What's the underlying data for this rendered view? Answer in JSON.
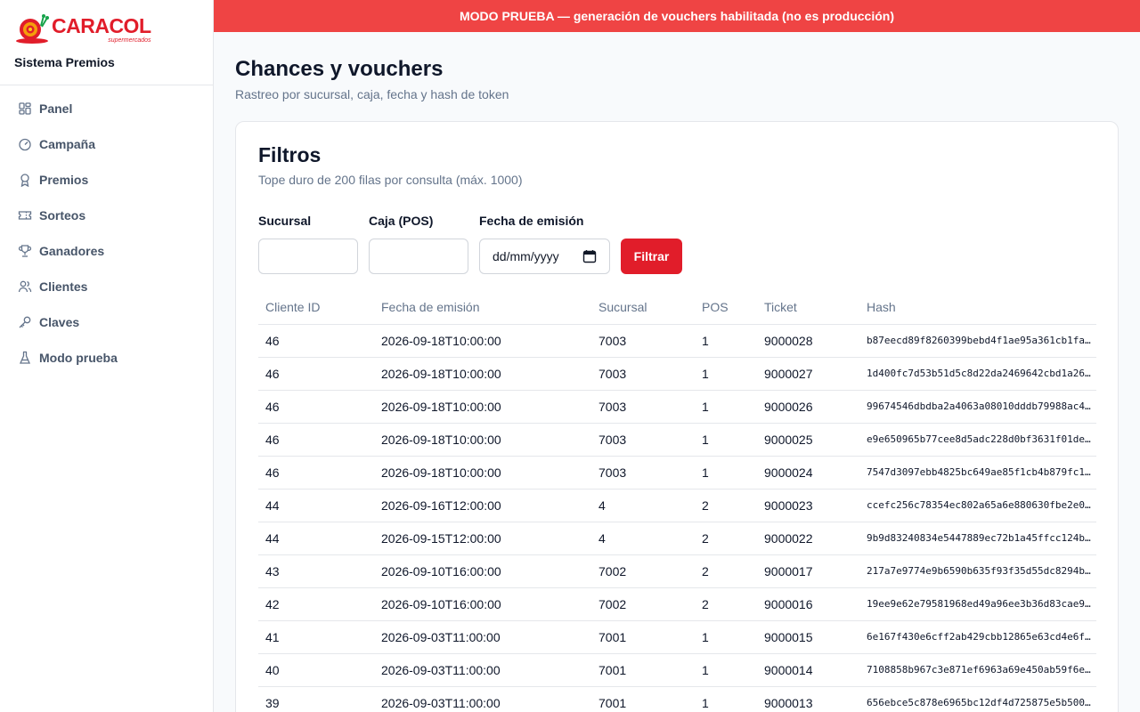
{
  "brand": {
    "logo_word": "CARACOL",
    "logo_sub": "supermercados",
    "system_name": "Sistema Premios"
  },
  "sidebar": {
    "items": [
      {
        "label": "Panel",
        "icon": "grid-icon"
      },
      {
        "label": "Campaña",
        "icon": "gauge-icon"
      },
      {
        "label": "Premios",
        "icon": "award-icon"
      },
      {
        "label": "Sorteos",
        "icon": "ticket-icon"
      },
      {
        "label": "Ganadores",
        "icon": "trophy-icon"
      },
      {
        "label": "Clientes",
        "icon": "users-icon"
      },
      {
        "label": "Claves",
        "icon": "key-icon"
      },
      {
        "label": "Modo prueba",
        "icon": "flask-icon"
      }
    ]
  },
  "banner": {
    "text": "MODO PRUEBA — generación de vouchers habilitada (no es producción)"
  },
  "page": {
    "title": "Chances y vouchers",
    "subtitle": "Rastreo por sucursal, caja, fecha y hash de token"
  },
  "filters": {
    "title": "Filtros",
    "subtitle": "Tope duro de 200 filas por consulta (máx. 1000)",
    "sucursal_label": "Sucursal",
    "sucursal_value": "",
    "caja_label": "Caja (POS)",
    "caja_value": "",
    "fecha_label": "Fecha de emisión",
    "fecha_placeholder": "dd/mm/yyyy",
    "button_label": "Filtrar"
  },
  "table": {
    "columns": [
      "Cliente ID",
      "Fecha de emisión",
      "Sucursal",
      "POS",
      "Ticket",
      "Hash"
    ],
    "rows": [
      [
        "46",
        "2026-09-18T10:00:00",
        "7003",
        "1",
        "9000028",
        "b87eecd89f8260399bebd4f1ae95a361cb1fa…"
      ],
      [
        "46",
        "2026-09-18T10:00:00",
        "7003",
        "1",
        "9000027",
        "1d400fc7d53b51d5c8d22da2469642cbd1a26…"
      ],
      [
        "46",
        "2026-09-18T10:00:00",
        "7003",
        "1",
        "9000026",
        "99674546dbdba2a4063a08010dddb79988ac4…"
      ],
      [
        "46",
        "2026-09-18T10:00:00",
        "7003",
        "1",
        "9000025",
        "e9e650965b77cee8d5adc228d0bf3631f01de…"
      ],
      [
        "46",
        "2026-09-18T10:00:00",
        "7003",
        "1",
        "9000024",
        "7547d3097ebb4825bc649ae85f1cb4b879fc1…"
      ],
      [
        "44",
        "2026-09-16T12:00:00",
        "4",
        "2",
        "9000023",
        "ccefc256c78354ec802a65a6e880630fbe2e0…"
      ],
      [
        "44",
        "2026-09-15T12:00:00",
        "4",
        "2",
        "9000022",
        "9b9d83240834e5447889ec72b1a45ffcc124b…"
      ],
      [
        "43",
        "2026-09-10T16:00:00",
        "7002",
        "2",
        "9000017",
        "217a7e9774e9b6590b635f93f35d55dc8294b…"
      ],
      [
        "42",
        "2026-09-10T16:00:00",
        "7002",
        "2",
        "9000016",
        "19ee9e62e79581968ed49a96ee3b36d83cae9…"
      ],
      [
        "41",
        "2026-09-03T11:00:00",
        "7001",
        "1",
        "9000015",
        "6e167f430e6cff2ab429cbb12865e63cd4e6f…"
      ],
      [
        "40",
        "2026-09-03T11:00:00",
        "7001",
        "1",
        "9000014",
        "7108858b967c3e871ef6963a69e450ab59f6e…"
      ],
      [
        "39",
        "2026-09-03T11:00:00",
        "7001",
        "1",
        "9000013",
        "656ebce5c878e6965bc12df4d725875e5b500…"
      ]
    ]
  },
  "colors": {
    "accent": "#e11d2a",
    "banner": "#ef4444",
    "muted": "#64748b",
    "border": "#e5e7eb"
  }
}
